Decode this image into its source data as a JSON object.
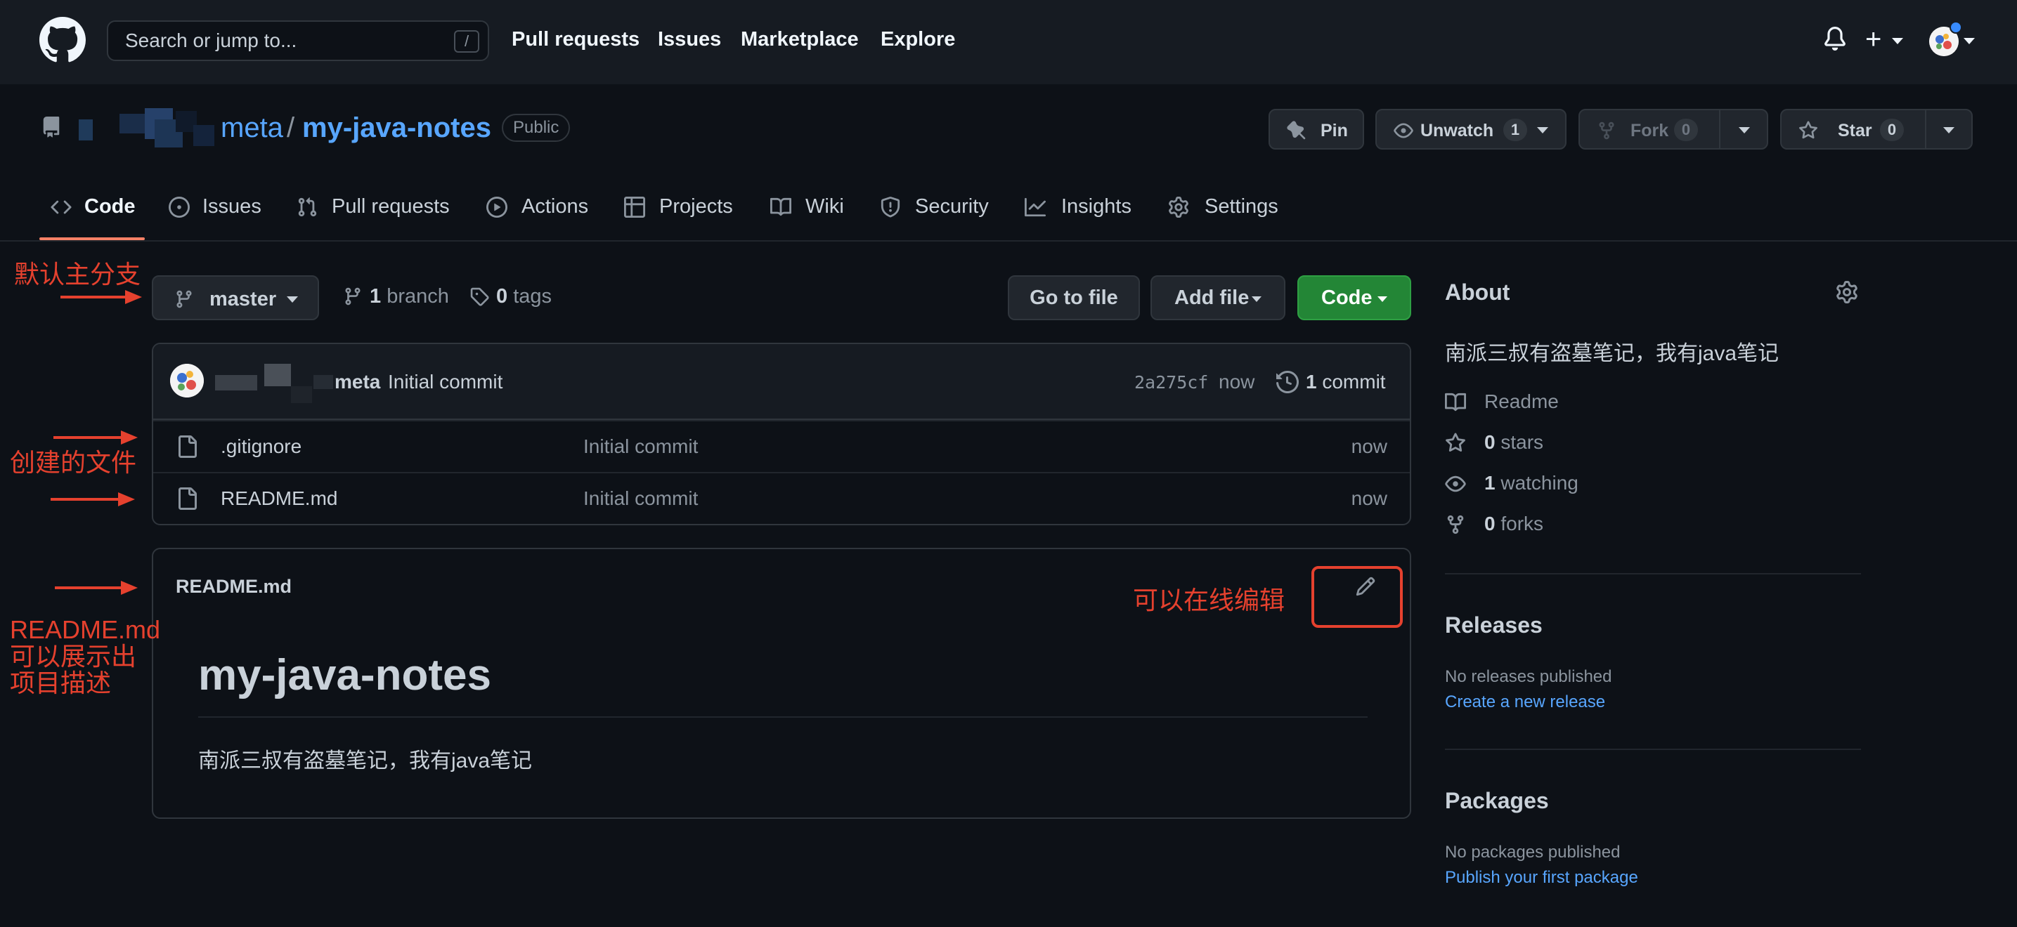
{
  "header": {
    "search_placeholder": "Search or jump to...",
    "search_shortcut": "/",
    "nav": [
      "Pull requests",
      "Issues",
      "Marketplace",
      "Explore"
    ]
  },
  "repo": {
    "owner": "meta",
    "separator": "/",
    "name": "my-java-notes",
    "visibility": "Public",
    "pin_label": "Pin",
    "unwatch_label": "Unwatch",
    "watch_count": "1",
    "fork_label": "Fork",
    "fork_count": "0",
    "star_label": "Star",
    "star_count": "0"
  },
  "tabs": [
    {
      "label": "Code",
      "icon": "code-icon",
      "active": true
    },
    {
      "label": "Issues",
      "icon": "issue-icon"
    },
    {
      "label": "Pull requests",
      "icon": "pull-request-icon"
    },
    {
      "label": "Actions",
      "icon": "play-icon"
    },
    {
      "label": "Projects",
      "icon": "table-icon"
    },
    {
      "label": "Wiki",
      "icon": "book-icon"
    },
    {
      "label": "Security",
      "icon": "shield-icon"
    },
    {
      "label": "Insights",
      "icon": "graph-icon"
    },
    {
      "label": "Settings",
      "icon": "gear-icon"
    }
  ],
  "branch_bar": {
    "branch": "master",
    "branch_count": "1",
    "branch_word": "branch",
    "tag_count": "0",
    "tag_word": "tags",
    "go_to_file": "Go to file",
    "add_file": "Add file",
    "code": "Code"
  },
  "commit": {
    "author": "meta",
    "message": "Initial commit",
    "sha": "2a275cf",
    "time": "now",
    "count": "1",
    "count_word": "commit"
  },
  "files": [
    {
      "name": ".gitignore",
      "message": "Initial commit",
      "age": "now"
    },
    {
      "name": "README.md",
      "message": "Initial commit",
      "age": "now"
    }
  ],
  "readme": {
    "title": "README.md",
    "heading": "my-java-notes",
    "description": "南派三叔有盗墓笔记，我有java笔记"
  },
  "sidebar": {
    "about_title": "About",
    "about_desc": "南派三叔有盗墓笔记，我有java笔记",
    "readme": "Readme",
    "stars_count": "0",
    "stars_word": "stars",
    "watching_count": "1",
    "watching_word": "watching",
    "forks_count": "0",
    "forks_word": "forks",
    "releases_title": "Releases",
    "no_releases": "No releases published",
    "create_release": "Create a new release",
    "packages_title": "Packages",
    "no_packages": "No packages published",
    "publish_package": "Publish your first package"
  },
  "annotations": {
    "default_branch": "默认主分支",
    "created_files": "创建的文件",
    "online_edit": "可以在线编辑",
    "readme_line1": "README.md",
    "readme_line2": "可以展示出",
    "readme_line3": "项目描述"
  },
  "colors": {
    "background": "#0d1117",
    "header_bg": "#161b22",
    "link": "#58a6ff",
    "code_button": "#238636",
    "active_tab": "#f78166",
    "annotation": "#e5412e"
  }
}
